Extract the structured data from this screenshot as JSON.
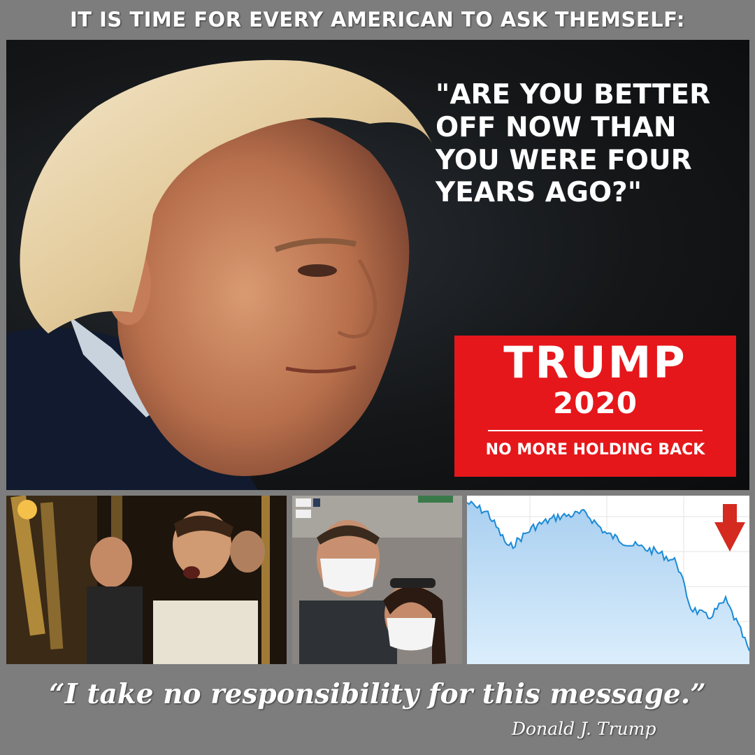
{
  "header": {
    "title": "IT IS TIME FOR EVERY AMERICAN TO ASK THEMSELF:"
  },
  "hero": {
    "quote": "\"ARE YOU BETTER\nOFF NOW THAN\nYOU WERE FOUR\nYEARS AGO?\"",
    "badge": {
      "line1": "TRUMP",
      "line2": "2020",
      "line3": "NO MORE HOLDING BACK",
      "color": "#e5171b"
    }
  },
  "panels": {
    "chart_arrow": "down-arrow-icon",
    "arrow_color": "#d42a1f",
    "line_color": "#1a8ad6"
  },
  "footer": {
    "quote": "“I take no responsibility for this message.”",
    "signature": "Donald J. Trump"
  }
}
